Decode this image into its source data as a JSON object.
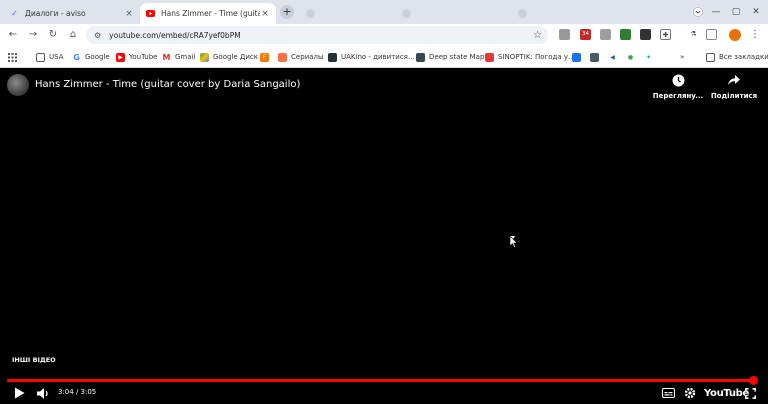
{
  "browser": {
    "tabs": [
      {
        "label": "Диалоги - aviso",
        "close": "×"
      },
      {
        "label": "Hans Zimmer - Time (guitar cove",
        "close": "×"
      }
    ],
    "new_tab": "+",
    "url": "youtube.com/embed/cRA7yef0bPM",
    "bookmarks": [
      {
        "label": "USA"
      },
      {
        "label": "Google"
      },
      {
        "label": "YouTube"
      },
      {
        "label": "Gmail"
      },
      {
        "label": "Google Диск"
      },
      {
        "label": "Сериалы"
      },
      {
        "label": "UAKino - дивитися..."
      },
      {
        "label": "Deep state Map"
      },
      {
        "label": "SINOPTIK: Погода у..."
      },
      {
        "label": "Все закладки"
      }
    ],
    "ext_badge": "34",
    "colors": {
      "accent": "#ff0000",
      "tabstrip": "#dfe3eb",
      "profile": "#e8710a"
    }
  },
  "player": {
    "title": "Hans Zimmer - Time (guitar cover by Daria Sangailo)",
    "watch_later_label": "Переглянy...",
    "share_label": "Поділитися",
    "more_videos": "ІНШІ ВІДЕО",
    "time": "3:04 / 3:05",
    "progress_fraction": 0.995,
    "brand": "YouTube"
  }
}
